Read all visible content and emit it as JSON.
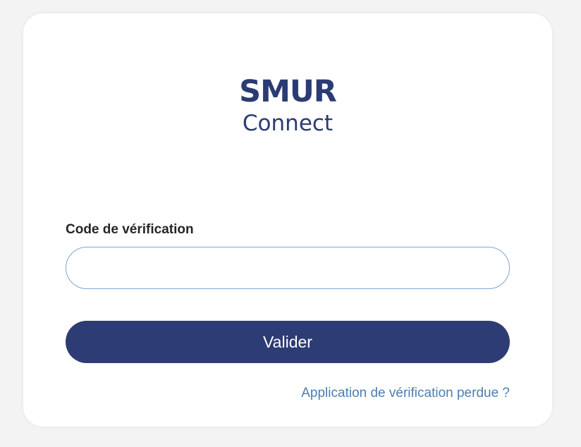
{
  "logo": {
    "main": "SMUR",
    "sub": "Connect"
  },
  "form": {
    "code_label": "Code de vérification",
    "code_value": "",
    "submit_label": "Valider",
    "lost_link": "Application de vérification perdue ?"
  },
  "colors": {
    "background": "#f3f3f3",
    "brand": "#2d3c74",
    "link": "#4a7fb2",
    "input_border": "#7fa6cf"
  }
}
